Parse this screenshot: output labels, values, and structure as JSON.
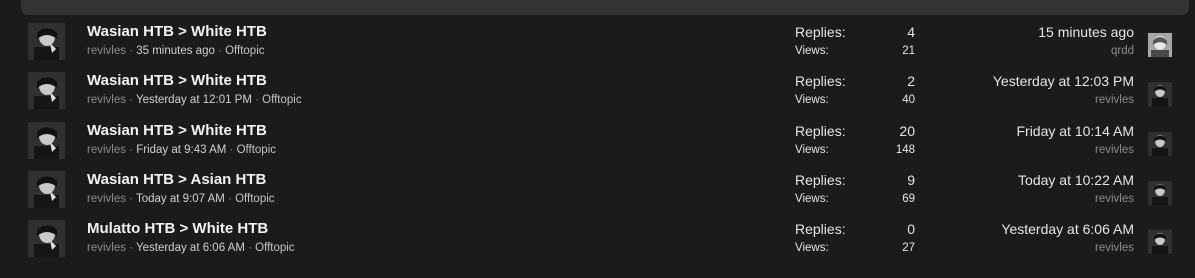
{
  "threads": [
    {
      "title": "Wasian HTB > White HTB",
      "author": "revivles",
      "started": "35 minutes ago",
      "forum": "Offtopic",
      "replies_label": "Replies:",
      "replies": "4",
      "views_label": "Views:",
      "views": "21",
      "last_date": "15 minutes ago",
      "last_user": "qrdd",
      "last_avatar": "light"
    },
    {
      "title": "Wasian HTB > White HTB",
      "author": "revivles",
      "started": "Yesterday at 12:01 PM",
      "forum": "Offtopic",
      "replies_label": "Replies:",
      "replies": "2",
      "views_label": "Views:",
      "views": "40",
      "last_date": "Yesterday at 12:03 PM",
      "last_user": "revivles",
      "last_avatar": "dark"
    },
    {
      "title": "Wasian HTB > White HTB",
      "author": "revivles",
      "started": "Friday at 9:43 AM",
      "forum": "Offtopic",
      "replies_label": "Replies:",
      "replies": "20",
      "views_label": "Views:",
      "views": "148",
      "last_date": "Friday at 10:14 AM",
      "last_user": "revivles",
      "last_avatar": "dark"
    },
    {
      "title": "Wasian HTB > Asian HTB",
      "author": "revivles",
      "started": "Today at 9:07 AM",
      "forum": "Offtopic",
      "replies_label": "Replies:",
      "replies": "9",
      "views_label": "Views:",
      "views": "69",
      "last_date": "Today at 10:22 AM",
      "last_user": "revivles",
      "last_avatar": "dark"
    },
    {
      "title": "Mulatto HTB > White HTB",
      "author": "revivles",
      "started": "Yesterday at 6:06 AM",
      "forum": "Offtopic",
      "replies_label": "Replies:",
      "replies": "0",
      "views_label": "Views:",
      "views": "27",
      "last_date": "Yesterday at 6:06 AM",
      "last_user": "revivles",
      "last_avatar": "dark"
    }
  ],
  "separator": " · "
}
